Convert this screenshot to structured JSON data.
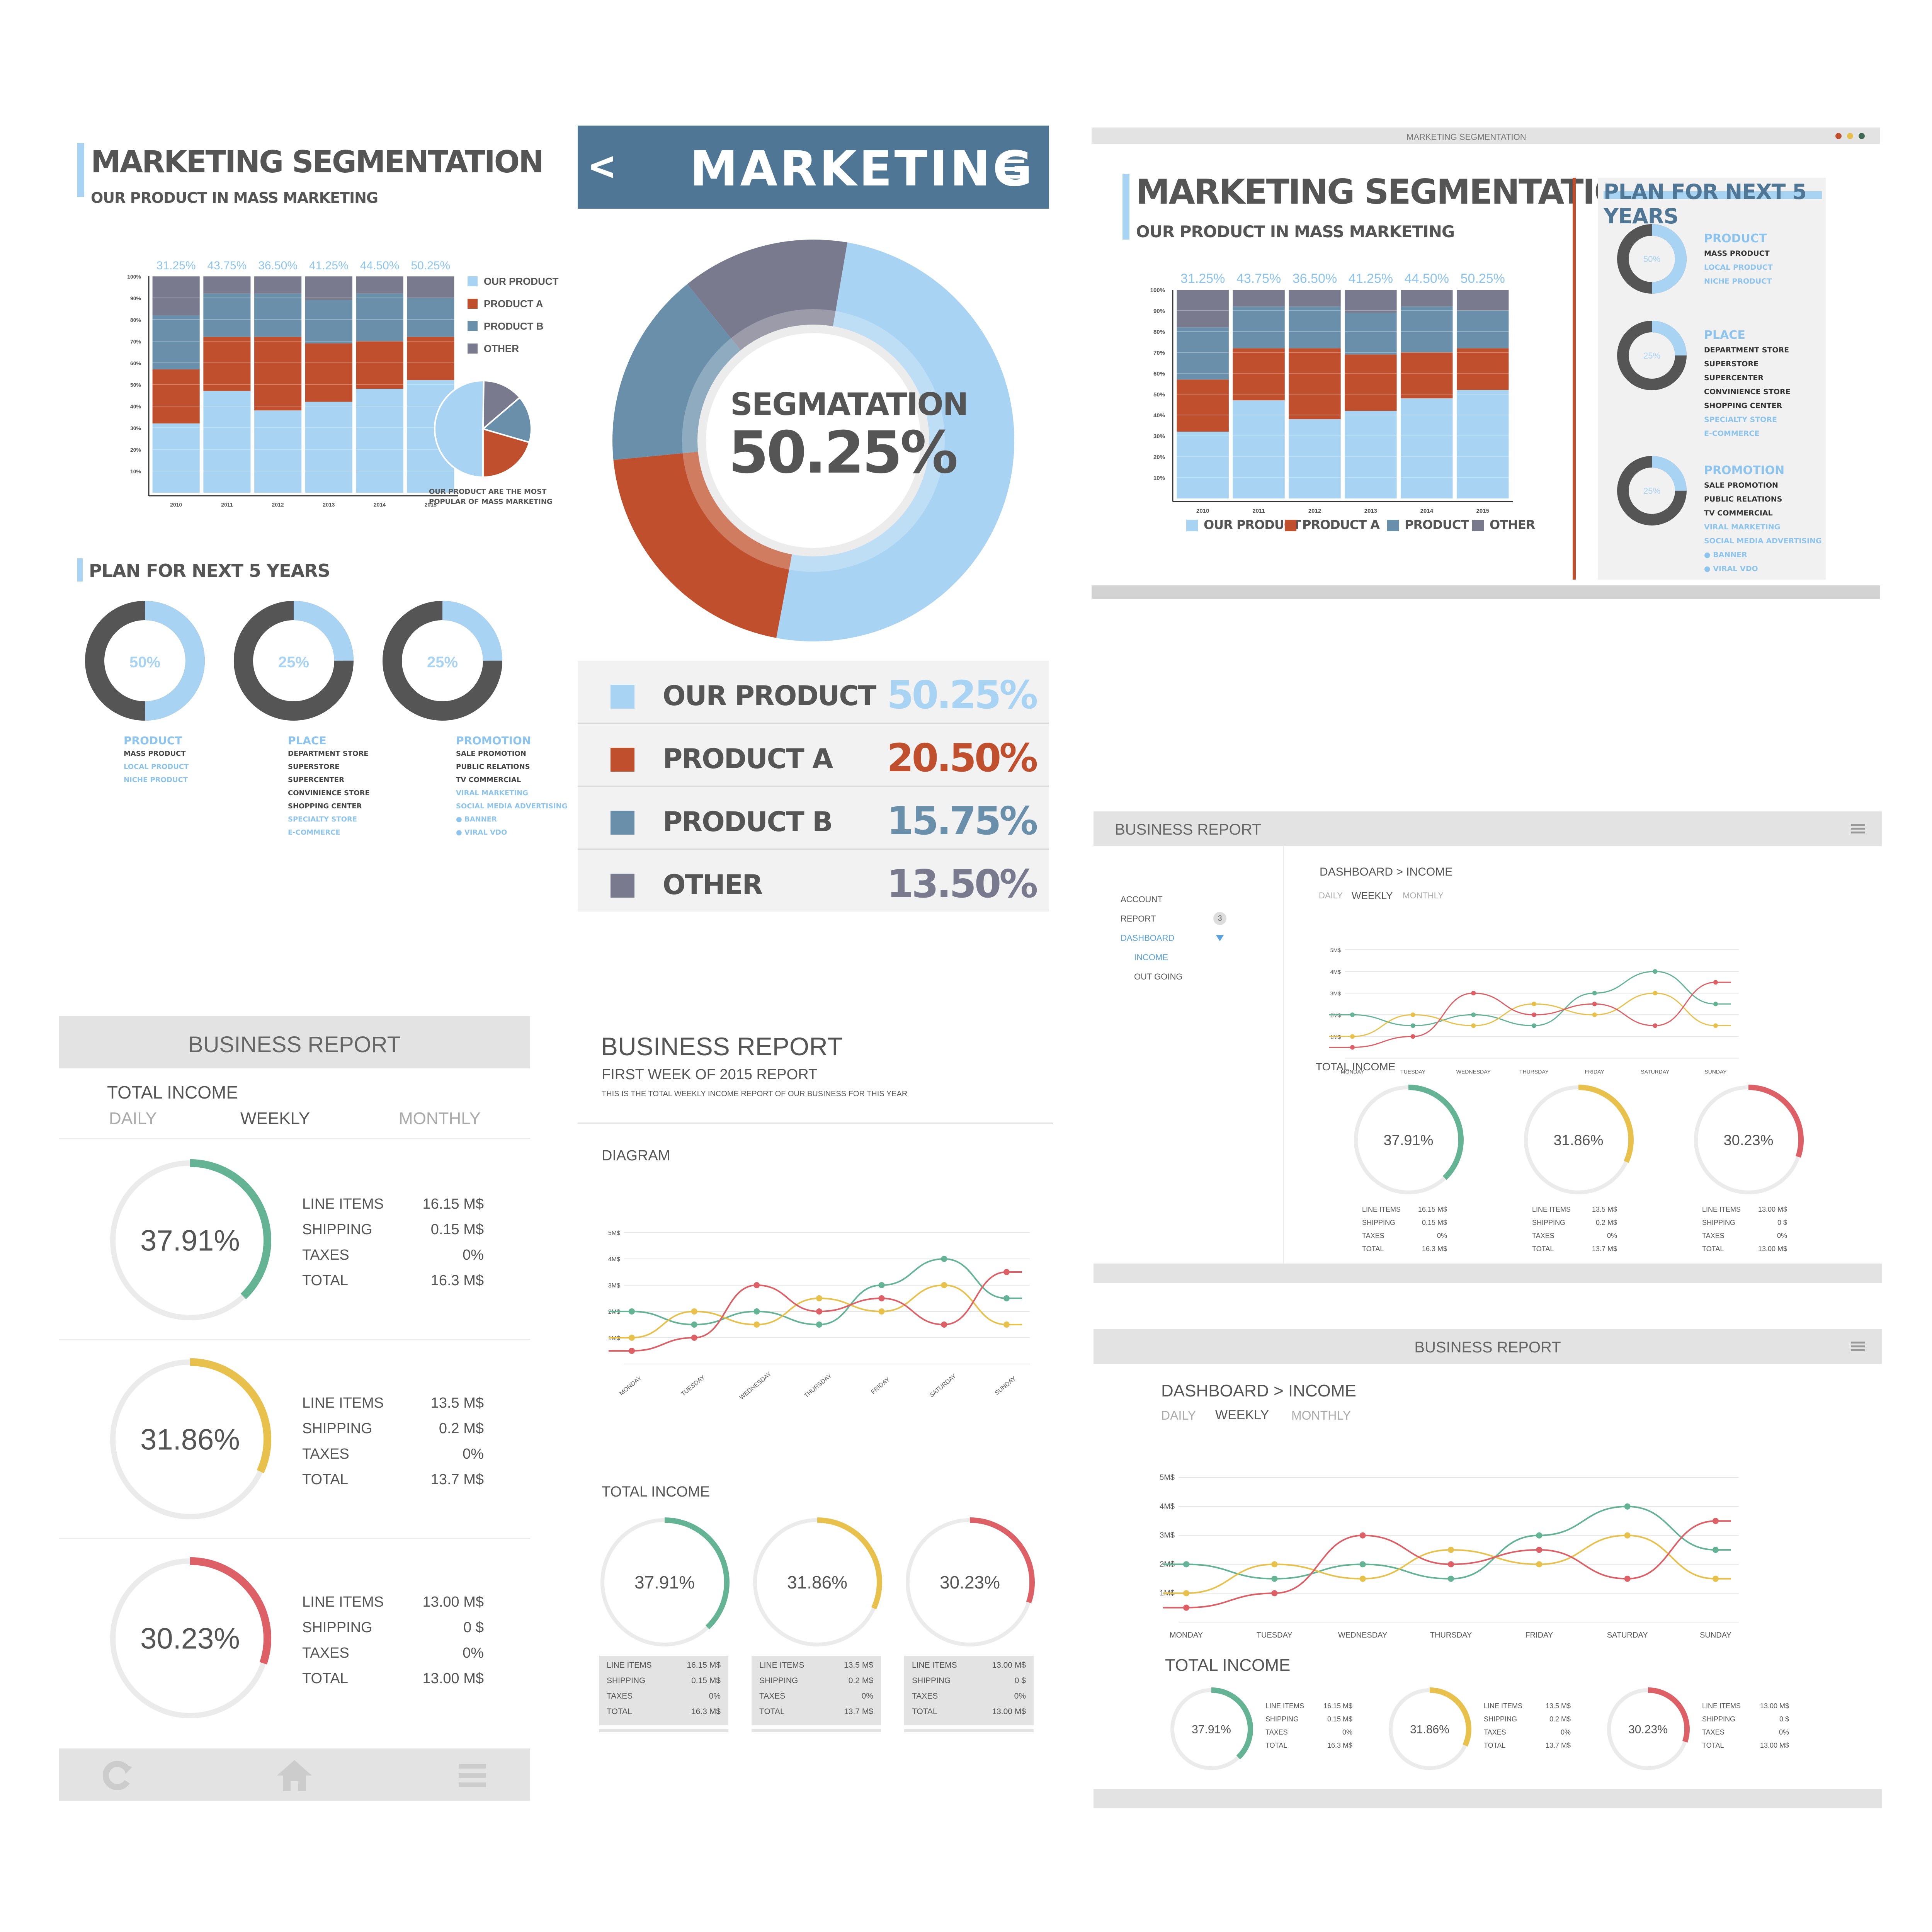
{
  "colors": {
    "light_blue": "#a8d3f3",
    "red": "#c0502d",
    "steel_blue": "#6a8fab",
    "purple_gray": "#7a7a8e",
    "dark_gray": "#555555",
    "header_blue": "#4f7694",
    "green": "#63b394",
    "yellow": "#e8c14d",
    "pink_red": "#dd6066"
  },
  "seg_left": {
    "title": "MARKETING SEGMENTATION",
    "subtitle": "OUR PRODUCT IN MASS MARKETING",
    "pie_caption_1": "OUR PRODUCT ARE THE MOST",
    "pie_caption_2": "POPULAR OF MASS MARKETING",
    "plan_title": "PLAN  FOR  NEXT 5 YEARS",
    "plan": [
      {
        "pct": "50%",
        "fraction": 0.5,
        "heading": "PRODUCT",
        "lines": [
          [
            "MASS PRODUCT",
            false
          ],
          [
            "LOCAL PRODUCT",
            true
          ],
          [
            "NICHE PRODUCT",
            true
          ]
        ]
      },
      {
        "pct": "25%",
        "fraction": 0.25,
        "heading": "PLACE",
        "lines": [
          [
            "DEPARTMENT STORE",
            false
          ],
          [
            "SUPERSTORE",
            false
          ],
          [
            "SUPERCENTER",
            false
          ],
          [
            "CONVINIENCE STORE",
            false
          ],
          [
            "SHOPPING CENTER",
            false
          ],
          [
            "SPECIALTY STORE",
            true
          ],
          [
            "E-COMMERCE",
            true
          ]
        ]
      },
      {
        "pct": "25%",
        "fraction": 0.25,
        "heading": "PROMOTION",
        "lines": [
          [
            "SALE  PROMOTION",
            false
          ],
          [
            "PUBLIC RELATIONS",
            false
          ],
          [
            "TV COMMERCIAL",
            false
          ],
          [
            "VIRAL MARKETING",
            true
          ],
          [
            "SOCIAL MEDIA ADVERTISING",
            true
          ],
          [
            "● BANNER",
            true
          ],
          [
            "● VIRAL VDO",
            true
          ]
        ]
      }
    ]
  },
  "chart_data": [
    {
      "type": "bar",
      "stacked": true,
      "categories": [
        "2010",
        "2011",
        "2012",
        "2013",
        "2014",
        "2015"
      ],
      "top_labels": [
        "31.25%",
        "43.75%",
        "36.50%",
        "41.25%",
        "44.50%",
        "50.25%"
      ],
      "yticks": [
        "10%",
        "20%",
        "30%",
        "40%",
        "50%",
        "60%",
        "70%",
        "80%",
        "90%",
        "100%"
      ],
      "ylim": [
        0,
        100
      ],
      "series": [
        {
          "name": "OUR PRODUCT",
          "values": [
            32,
            47,
            38,
            42,
            48,
            52
          ]
        },
        {
          "name": "PRODUCT A",
          "values": [
            25,
            25,
            34,
            27,
            22,
            20
          ]
        },
        {
          "name": "PRODUCT B",
          "values": [
            25,
            20,
            20,
            20,
            22,
            18
          ]
        },
        {
          "name": "OTHER",
          "values": [
            18,
            8,
            8,
            11,
            8,
            10
          ]
        }
      ]
    },
    {
      "type": "pie",
      "categories": [
        "OUR PRODUCT",
        "PRODUCT A",
        "PRODUCT B",
        "OTHER"
      ],
      "values": [
        50.25,
        20.5,
        15.75,
        13.5
      ]
    },
    {
      "type": "line",
      "categories": [
        "MONDAY",
        "TUESDAY",
        "WEDNESDAY",
        "THURSDAY",
        "FRIDAY",
        "SATURDAY",
        "SUNDAY"
      ],
      "yticks": [
        "1M$",
        "2M$",
        "3M$",
        "4M$",
        "5M$"
      ],
      "ylim": [
        0,
        5
      ],
      "series": [
        {
          "values": [
            2.0,
            1.5,
            2.0,
            1.5,
            3.0,
            4.0,
            2.5
          ],
          "color": "#63b394"
        },
        {
          "values": [
            1.0,
            2.0,
            1.5,
            2.5,
            2.0,
            3.0,
            1.5
          ],
          "color": "#e8c14d"
        },
        {
          "values": [
            0.5,
            1.0,
            3.0,
            2.0,
            2.5,
            1.5,
            3.5
          ],
          "color": "#dd6066"
        }
      ]
    }
  ],
  "marketing": {
    "title": "MARKETING",
    "back": "<",
    "menu": "≡",
    "center_label": "SEGMATATION",
    "center_value": "50.25%",
    "rows": [
      {
        "label": "OUR PRODUCT",
        "value": "50.25%",
        "color": "#a8d3f3"
      },
      {
        "label": "PRODUCT A",
        "value": "20.50%",
        "color": "#c0502d"
      },
      {
        "label": "PRODUCT B",
        "value": "15.75%",
        "color": "#6a8fab"
      },
      {
        "label": "OTHER",
        "value": "13.50%",
        "color": "#7a7a8e"
      }
    ]
  },
  "seg_window": {
    "window_title": "MARKETING SEGMENTATION",
    "title": "MARKETING SEGMENTATION",
    "subtitle": "OUR PRODUCT IN MASS MARKETING",
    "plan_title": "PLAN FOR NEXT 5 YEARS"
  },
  "income": {
    "title": "BUSINESS REPORT",
    "total_income": "TOTAL INCOME",
    "tabs": [
      "DAILY",
      "WEEKLY",
      "MONTHLY"
    ],
    "line_labels": [
      "LINE ITEMS",
      "SHIPPING",
      "TAXES",
      "TOTAL"
    ],
    "rings": [
      {
        "pct": "37.91%",
        "fraction": 0.3791,
        "color": "#63b394",
        "values": [
          "16.15 M$",
          "0.15 M$",
          "0%",
          "16.3 M$"
        ]
      },
      {
        "pct": "31.86%",
        "fraction": 0.3186,
        "color": "#e8c14d",
        "values": [
          "13.5 M$",
          "0.2 M$",
          "0%",
          "13.7 M$"
        ]
      },
      {
        "pct": "30.23%",
        "fraction": 0.3023,
        "color": "#dd6066",
        "values": [
          "13.00 M$",
          "0 $",
          "0%",
          "13.00 M$"
        ]
      }
    ],
    "small_values": [
      [
        "16.15 M$",
        "0.15 M$",
        "0%",
        "16.3 M$"
      ],
      [
        "13.5 M$",
        "0.2 M$",
        "0%",
        "13.7 M$"
      ],
      [
        "13.00 M$",
        "0 $",
        "0%",
        "13.00 M$"
      ]
    ]
  },
  "report_center": {
    "title": "BUSINESS REPORT",
    "subtitle": "FIRST WEEK OF 2015  REPORT",
    "desc": "THIS IS THE TOTAL WEEKLY INCOME REPORT OF OUR BUSINESS FOR THIS YEAR",
    "diagram": "DIAGRAM",
    "total_income": "TOTAL INCOME"
  },
  "report_dashboard": {
    "title": "BUSINESS REPORT",
    "nav": [
      "ACCOUNT",
      "REPORT",
      "DASHBOARD",
      "INCOME",
      "OUT GOING"
    ],
    "badge": "3",
    "breadcrumb": "DASHBOARD  >  INCOME",
    "total_income": "TOTAL INCOME"
  },
  "report_bottom": {
    "title": "BUSINESS REPORT",
    "breadcrumb": "DASHBOARD  >  INCOME",
    "total_income": "TOTAL INCOME"
  }
}
